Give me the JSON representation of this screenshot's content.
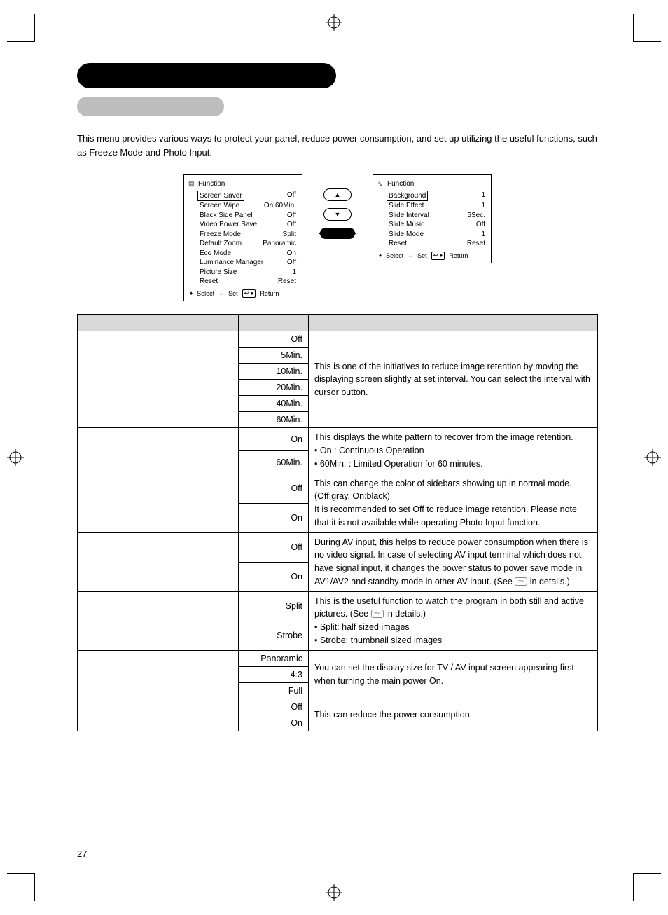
{
  "intro": "This menu provides various ways to protect your panel, reduce power consumption, and set up utilizing the useful functions, such as Freeze Mode and Photo Input.",
  "osd_left": {
    "title": "Function",
    "rows": [
      {
        "label": "Screen Saver",
        "value": "Off",
        "selected": true
      },
      {
        "label": "Screen Wipe",
        "value": "On 60Min."
      },
      {
        "label": "Black Side Panel",
        "value": "Off"
      },
      {
        "label": "Video Power Save",
        "value": "Off"
      },
      {
        "label": "Freeze Mode",
        "value": "Split"
      },
      {
        "label": "Default Zoom",
        "value": "Panoramic"
      },
      {
        "label": "Eco Mode",
        "value": "On"
      },
      {
        "label": "Luminance Manager",
        "value": "Off"
      },
      {
        "label": "Picture Size",
        "value": "1"
      },
      {
        "label": "Reset",
        "value": "Reset"
      }
    ],
    "foot": {
      "select": "Select",
      "set": "Set",
      "return": "Return"
    }
  },
  "osd_right": {
    "title": "Function",
    "rows": [
      {
        "label": "Background",
        "value": "1",
        "selected": true
      },
      {
        "label": "Slide Effect",
        "value": "1"
      },
      {
        "label": "Slide Interval",
        "value": "5Sec."
      },
      {
        "label": "Slide Music",
        "value": "Off"
      },
      {
        "label": "Slide Mode",
        "value": "1"
      },
      {
        "label": "Reset",
        "value": "Reset"
      }
    ],
    "foot": {
      "select": "Select",
      "set": "Set",
      "return": "Return"
    }
  },
  "table": {
    "rows": [
      {
        "settings": [
          "Off",
          "5Min.",
          "10Min.",
          "20Min.",
          "40Min.",
          "60Min."
        ],
        "desc": "This is one of the initiatives to reduce image retention by moving the displaying screen slightly at set interval. You can select the interval with cursor button."
      },
      {
        "settings": [
          "On",
          "60Min."
        ],
        "desc": "This displays the white pattern to recover from the image retention.\n• On : Continuous Operation\n• 60Min. : Limited Operation for 60 minutes."
      },
      {
        "settings": [
          "Off",
          "On"
        ],
        "desc": "This can change the color of sidebars showing up in normal mode. (Off:gray, On:black)\nIt is recommended to set Off to reduce image retention. Please note that it is not available while operating Photo Input function."
      },
      {
        "settings": [
          "Off",
          "On"
        ],
        "desc": "During AV input, this helps to reduce power consumption when there is no video signal. In case of selecting AV input terminal which does not have signal input, it changes the power status to power save mode in AV1/AV2 and standby mode in other AV input. (See __PAGE__ in details.)"
      },
      {
        "settings": [
          "Split",
          "Strobe"
        ],
        "desc": "This is the useful function to watch the program in both still and active pictures. (See __PAGE__ in details.)\n• Split: half sized images\n• Strobe: thumbnail sized images"
      },
      {
        "settings": [
          "Panoramic",
          "4:3",
          "Full"
        ],
        "desc": "You can set the display size for TV / AV input screen appearing first when turning the main power On."
      },
      {
        "settings": [
          "Off",
          "On"
        ],
        "desc": "This can reduce the power consumption."
      }
    ]
  },
  "page_number": "27"
}
